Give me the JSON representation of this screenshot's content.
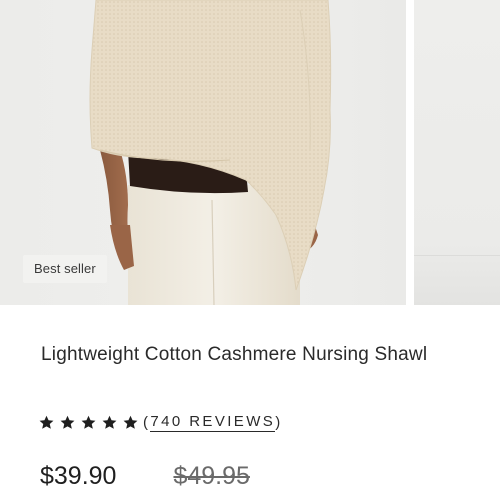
{
  "gallery": {
    "badge": "Best seller"
  },
  "product": {
    "title": "Lightweight Cotton Cashmere Nursing Shawl",
    "rating": 5,
    "rating_max": 5,
    "reviews_open": "(",
    "reviews_label": "740 REVIEWS",
    "reviews_close": ")",
    "price": "$39.90",
    "compare_at_price": "$49.95"
  },
  "colors": {
    "text": "#2a2a2a",
    "badge_bg": "#f2f2f0",
    "knit": "#e6d9c2",
    "pants": "#efe9dc",
    "top": "#2a1c16"
  }
}
